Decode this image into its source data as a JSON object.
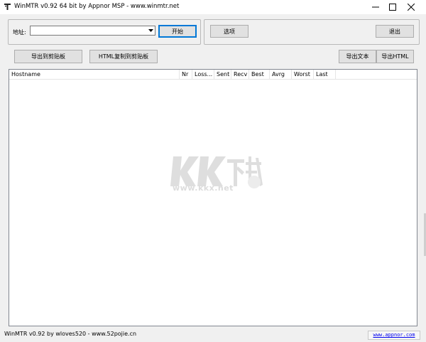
{
  "window": {
    "title": "WinMTR v0.92 64 bit by Appnor MSP - www.winmtr.net",
    "icon": "winmtr-app-icon"
  },
  "controls": {
    "minimize_icon": "minimize-icon",
    "maximize_icon": "maximize-icon",
    "close_icon": "close-icon"
  },
  "host": {
    "label": "地址:",
    "value": ""
  },
  "buttons": {
    "start": "开始",
    "options": "选项",
    "exit": "退出",
    "copy_text": "导出到剪贴板",
    "copy_html": "HTML复制到剪贴板",
    "export_text": "导出文本",
    "export_html": "导出HTML"
  },
  "table": {
    "columns": [
      "Hostname",
      "Nr",
      "Loss...",
      "Sent",
      "Recv",
      "Best",
      "Avrg",
      "Worst",
      "Last"
    ],
    "rows": []
  },
  "watermark": {
    "url": "www.kkx.net"
  },
  "status": {
    "text": "WinMTR v0.92 by wloves520 - www.52pojie.cn",
    "link": "www.appnor.com"
  }
}
